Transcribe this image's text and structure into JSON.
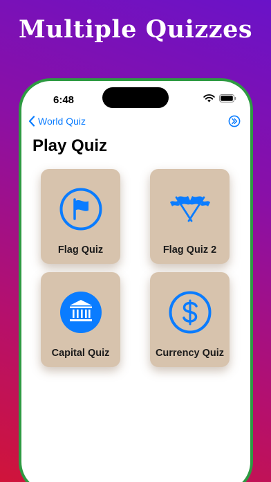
{
  "headline": "Multiple Quizzes",
  "status_bar": {
    "time": "6:48"
  },
  "nav": {
    "back_label": "World Quiz"
  },
  "page": {
    "title": "Play Quiz"
  },
  "tiles": [
    {
      "label": "Flag Quiz",
      "icon": "flag-circle-icon"
    },
    {
      "label": "Flag Quiz 2",
      "icon": "crossed-flags-icon"
    },
    {
      "label": "Capital Quiz",
      "icon": "bank-building-icon"
    },
    {
      "label": "Currency Quiz",
      "icon": "dollar-circle-icon"
    }
  ],
  "colors": {
    "accent": "#0a7cff",
    "tile_background": "#d7c3ad",
    "phone_frame": "#2e9a42"
  }
}
